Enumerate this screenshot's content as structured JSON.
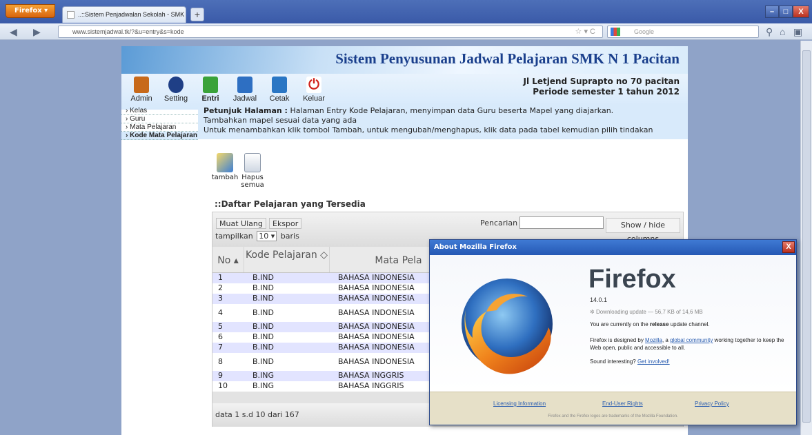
{
  "browser": {
    "menu_label": "Firefox ▾",
    "tab_title": "..::Sistem Penjadwalan Sekolah - SMK N 1 P...",
    "new_tab": "+",
    "url": "www.sistemjadwal.tk/?&u=entry&s=kode",
    "search_placeholder": "Google",
    "window_buttons": [
      "–",
      "□",
      "X"
    ]
  },
  "site": {
    "title": "Sistem Penyusunan Jadwal Pelajaran SMK N 1 Pacitan",
    "address_line1": "Jl Letjend Suprapto no 70 pacitan",
    "address_line2": "Periode semester 1 tahun 2012",
    "menu": [
      {
        "label": "Admin",
        "icon": "users-icon",
        "color": "#c7691a"
      },
      {
        "label": "Setting",
        "icon": "gear-icon",
        "color": "#1f3f86"
      },
      {
        "label": "Entri",
        "icon": "add-entry-icon",
        "color": "#3aa23a"
      },
      {
        "label": "Jadwal",
        "icon": "calendar-icon",
        "color": "#2e6fc2"
      },
      {
        "label": "Cetak",
        "icon": "printer-icon",
        "color": "#2a76c4"
      },
      {
        "label": "Keluar",
        "icon": "power-icon",
        "color": "#d0211a"
      }
    ],
    "sidebar": [
      "Kelas",
      "Guru",
      "Mata Pelajaran",
      "Kode Mata Pelajaran"
    ],
    "hint_bold": "Petunjuk Halaman :",
    "hint_line1": " Halaman Entry Kode Pelajaran, menyimpan data Guru beserta Mapel yang diajarkan.",
    "hint_line2": "Tambahkan mapel sesuai data yang ada",
    "hint_line3": "Untuk menambahkan klik tombol Tambah, untuk mengubah/menghapus, klik data pada tabel kemudian pilih tindakan",
    "tools": [
      {
        "label": "tambah",
        "icon": "edit-icon"
      },
      {
        "label": "Hapus semua",
        "icon": "recycle-bin-icon"
      }
    ],
    "list_title": "::Daftar Pelajaran yang Tersedia"
  },
  "table": {
    "btn_reload": "Muat Ulang",
    "btn_export": "Ekspor",
    "search_label": "Pencarian",
    "show_hide": "Show / hide columns",
    "length_prefix": "tampilkan",
    "length_value": "10 ▾",
    "length_suffix": "baris",
    "headers": [
      "No ▴",
      "Kode Pelajaran ◇",
      "Mata Pela"
    ],
    "rows": [
      [
        "1",
        "B.IND",
        "BAHASA INDONESIA"
      ],
      [
        "2",
        "B.IND",
        "BAHASA INDONESIA"
      ],
      [
        "3",
        "B.IND",
        "BAHASA INDONESIA"
      ],
      [
        "4",
        "B.IND",
        "BAHASA INDONESIA"
      ],
      [
        "5",
        "B.IND",
        "BAHASA INDONESIA"
      ],
      [
        "6",
        "B.IND",
        "BAHASA INDONESIA"
      ],
      [
        "7",
        "B.IND",
        "BAHASA INDONESIA"
      ],
      [
        "8",
        "B.IND",
        "BAHASA INDONESIA"
      ],
      [
        "9",
        "B.ING",
        "BAHASA INGGRIS"
      ],
      [
        "10",
        "B.ING",
        "BAHASA INGGRIS"
      ]
    ],
    "footer": "data 1 s.d 10 dari 167"
  },
  "dialog": {
    "title": "About Mozilla Firefox",
    "close": "X",
    "product": "Firefox",
    "version": "14.0.1",
    "download": "Downloading update — 56,7 KB of 14,6 MB",
    "channel_pre": "You are currently on the ",
    "channel": "release",
    "channel_post": " update channel.",
    "desc_pre": "Firefox is designed by ",
    "desc_link1": "Mozilla",
    "desc_mid": ", a ",
    "desc_link2": "global community",
    "desc_post": " working together to keep the Web open, public and accessible to all.",
    "involved_pre": "Sound interesting? ",
    "involved_link": "Get involved!",
    "links": [
      "Licensing Information",
      "End-User Rights",
      "Privacy Policy"
    ],
    "trademark": "Firefox and the Firefox logos are trademarks of the Mozilla Foundation."
  }
}
